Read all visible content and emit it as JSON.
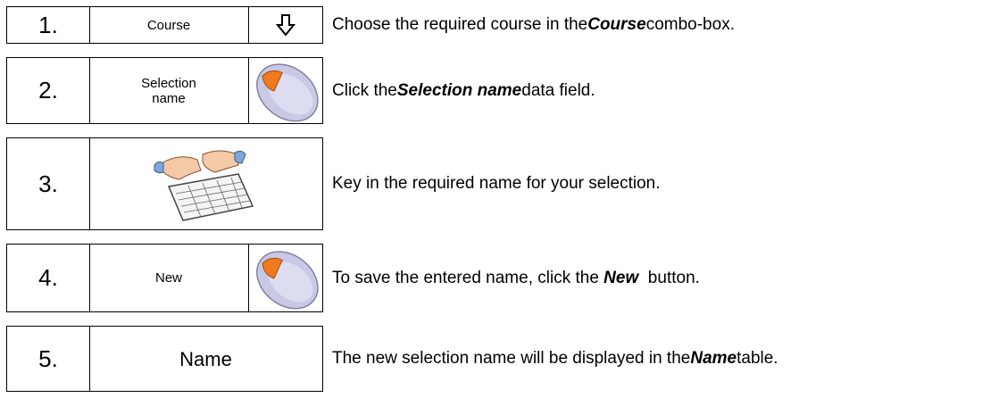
{
  "steps": [
    {
      "number": "1.",
      "label": "Course",
      "icon": "down-arrow-icon",
      "desc_pre": "Choose the required course in the ",
      "desc_bold": "Course",
      "desc_post": " combo-box."
    },
    {
      "number": "2.",
      "label": "Selection name",
      "icon": "mouse-click-icon",
      "desc_pre": "Click the ",
      "desc_bold": "Selection name",
      "desc_post": " data field."
    },
    {
      "number": "3.",
      "label": "",
      "icon": "keyboard-typing-icon",
      "desc_pre": "Key in the required name for your selection.",
      "desc_bold": "",
      "desc_post": ""
    },
    {
      "number": "4.",
      "label": "New",
      "icon": "mouse-click-icon",
      "desc_pre": "To save the entered name, click the ",
      "desc_bold": "New",
      "desc_post": "  button."
    },
    {
      "number": "5.",
      "label": "Name",
      "icon": "",
      "desc_pre": "The new selection name will be displayed in the ",
      "desc_bold": "Name",
      "desc_post": " table."
    }
  ],
  "colors": {
    "mouse_body": "#c9c9e6",
    "mouse_button": "#f07a1e",
    "outline": "#000000"
  }
}
